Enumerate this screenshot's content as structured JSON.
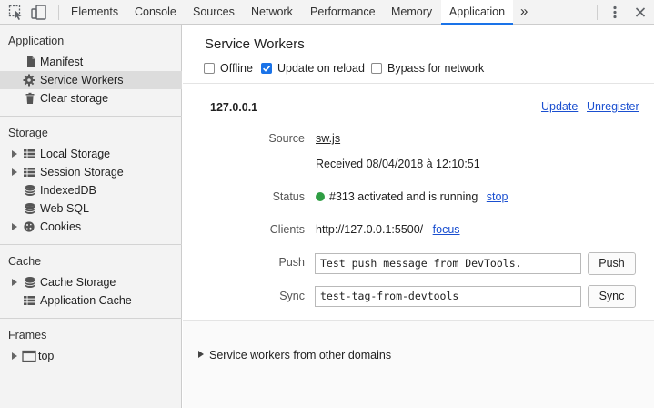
{
  "toolbar": {
    "tabs": [
      {
        "label": "Elements"
      },
      {
        "label": "Console"
      },
      {
        "label": "Sources"
      },
      {
        "label": "Network"
      },
      {
        "label": "Performance"
      },
      {
        "label": "Memory"
      },
      {
        "label": "Application"
      }
    ],
    "active_tab": "Application",
    "overflow_label": "»",
    "accent_color": "#1a73e8"
  },
  "sidebar": {
    "application": {
      "title": "Application",
      "items": [
        {
          "label": "Manifest",
          "icon": "file-icon"
        },
        {
          "label": "Service Workers",
          "icon": "gear-icon",
          "selected": true
        },
        {
          "label": "Clear storage",
          "icon": "trash-icon"
        }
      ]
    },
    "storage": {
      "title": "Storage",
      "items": [
        {
          "label": "Local Storage",
          "icon": "grid-icon",
          "expandable": true
        },
        {
          "label": "Session Storage",
          "icon": "grid-icon",
          "expandable": true
        },
        {
          "label": "IndexedDB",
          "icon": "database-icon"
        },
        {
          "label": "Web SQL",
          "icon": "database-icon"
        },
        {
          "label": "Cookies",
          "icon": "cookie-icon",
          "expandable": true
        }
      ]
    },
    "cache": {
      "title": "Cache",
      "items": [
        {
          "label": "Cache Storage",
          "icon": "database-icon",
          "expandable": true
        },
        {
          "label": "Application Cache",
          "icon": "grid-icon"
        }
      ]
    },
    "frames": {
      "title": "Frames",
      "items": [
        {
          "label": "top",
          "icon": "frame-icon",
          "expandable": true
        }
      ]
    }
  },
  "main": {
    "title": "Service Workers",
    "options": {
      "offline": {
        "label": "Offline",
        "checked": false
      },
      "update_on_reload": {
        "label": "Update on reload",
        "checked": true
      },
      "bypass": {
        "label": "Bypass for network",
        "checked": false
      }
    },
    "worker": {
      "origin": "127.0.0.1",
      "update_link": "Update",
      "unregister_link": "Unregister",
      "source_label": "Source",
      "source_link": "sw.js",
      "received": "Received 08/04/2018 à 12:10:51",
      "status_label": "Status",
      "status_text": "#313 activated and is running",
      "status_color": "#2f9e44",
      "stop_link": "stop",
      "clients_label": "Clients",
      "clients_value": "http://127.0.0.1:5500/",
      "focus_link": "focus",
      "push_label": "Push",
      "push_value": "Test push message from DevTools.",
      "push_button": "Push",
      "sync_label": "Sync",
      "sync_value": "test-tag-from-devtools",
      "sync_button": "Sync"
    },
    "other_domains": "Service workers from other domains"
  }
}
